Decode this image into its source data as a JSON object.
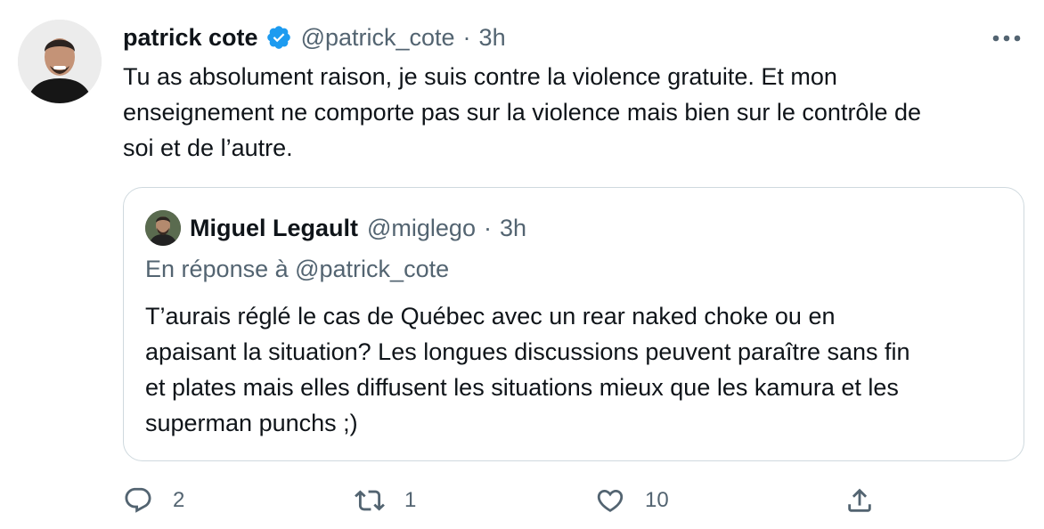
{
  "tweet": {
    "author_name": "patrick cote",
    "handle": "@patrick_cote",
    "separator": "·",
    "time": "3h",
    "verified": true,
    "text_lines": [
      "Tu as absolument raison, je suis contre la violence gratuite. Et mon",
      "enseignement ne comporte pas sur la violence mais bien sur le contrôle de",
      "soi et de l’autre."
    ],
    "more_icon": "more-icon"
  },
  "quoted_tweet": {
    "author_name": "Miguel Legault",
    "handle": "@miglego",
    "separator": "·",
    "time": "3h",
    "reply_context": "En réponse à @patrick_cote",
    "text_lines": [
      "T’aurais réglé le cas de Québec avec un rear naked choke ou en",
      "apaisant la situation? Les longues discussions peuvent paraître sans fin",
      "et plates mais elles diffusent les situations mieux que les kamura et les",
      "superman punchs ;)"
    ]
  },
  "actions": {
    "replies": "2",
    "retweets": "1",
    "likes": "10"
  },
  "colors": {
    "text": "#0f1419",
    "secondary": "#536471",
    "verified": "#1d9bf0",
    "border": "#cfd9de"
  }
}
